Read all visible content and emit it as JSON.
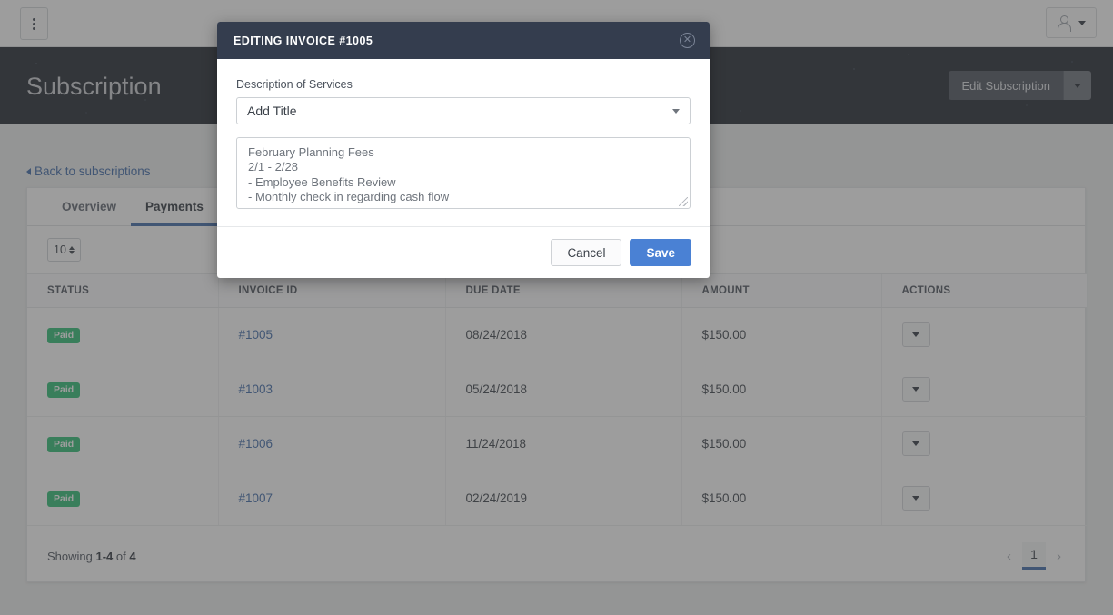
{
  "topbar": {
    "menu_icon": "kebab-menu-icon",
    "account_icon": "user-avatar-icon",
    "account_caret": "chevron-down-icon"
  },
  "hero": {
    "title": "Subscription",
    "edit_button": "Edit Subscription",
    "edit_caret": "chevron-down-icon"
  },
  "content": {
    "back_link": "Back to subscriptions",
    "tabs": [
      {
        "label": "Overview",
        "active": false
      },
      {
        "label": "Payments",
        "active": true
      }
    ],
    "page_size": "10"
  },
  "table": {
    "columns": [
      "STATUS",
      "INVOICE ID",
      "DUE DATE",
      "AMOUNT",
      "ACTIONS"
    ],
    "rows": [
      {
        "status": "Paid",
        "invoice_id": "#1005",
        "due_date": "08/24/2018",
        "amount": "$150.00",
        "action_icon": "chevron-down-icon"
      },
      {
        "status": "Paid",
        "invoice_id": "#1003",
        "due_date": "05/24/2018",
        "amount": "$150.00",
        "action_icon": "chevron-down-icon"
      },
      {
        "status": "Paid",
        "invoice_id": "#1006",
        "due_date": "11/24/2018",
        "amount": "$150.00",
        "action_icon": "chevron-down-icon"
      },
      {
        "status": "Paid",
        "invoice_id": "#1007",
        "due_date": "02/24/2019",
        "amount": "$150.00",
        "action_icon": "chevron-down-icon"
      }
    ]
  },
  "footer": {
    "showing_prefix": "Showing ",
    "showing_range": "1-4",
    "showing_middle": " of ",
    "showing_total": "4",
    "prev_label": "‹",
    "page_number": "1",
    "next_label": "›"
  },
  "modal": {
    "title": "EDITING INVOICE #1005",
    "close_icon": "close-circle-icon",
    "field_label": "Description of Services",
    "select_value": "Add Title",
    "select_caret": "chevron-down-icon",
    "textarea_value": "February Planning Fees\n2/1 - 2/28\n- Employee Benefits Review\n- Monthly check in regarding cash flow",
    "cancel_label": "Cancel",
    "save_label": "Save"
  },
  "colors": {
    "accent_blue": "#4a81d4",
    "link_blue": "#3d68a8",
    "badge_green": "#2cbe73",
    "hero_navy": "#1e242e",
    "modal_header": "#343d4e"
  }
}
